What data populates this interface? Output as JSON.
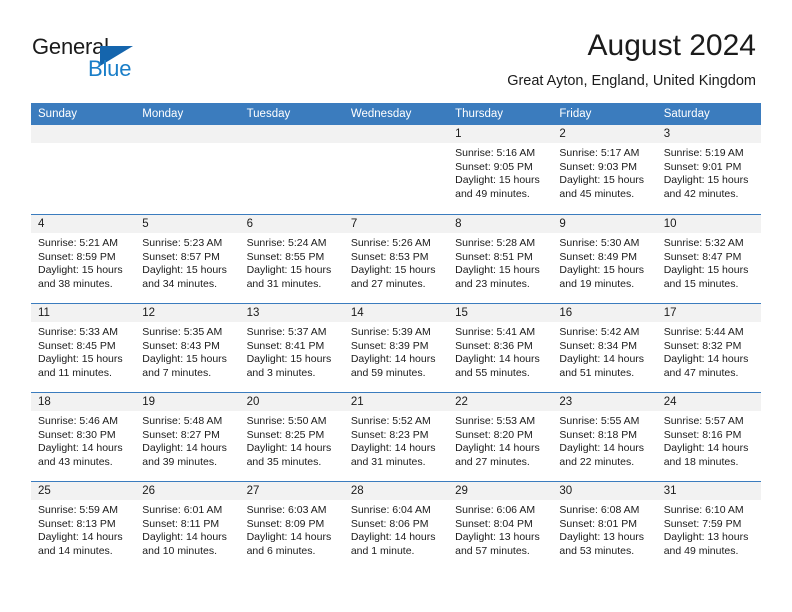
{
  "brand": {
    "name_part1": "General",
    "name_part2": "Blue",
    "triangle_color": "#1565ad",
    "blue_color": "#1a7ec8"
  },
  "header": {
    "title": "August 2024",
    "subtitle": "Great Ayton, England, United Kingdom",
    "accent_color": "#3b7cbe"
  },
  "weekdays": [
    "Sunday",
    "Monday",
    "Tuesday",
    "Wednesday",
    "Thursday",
    "Friday",
    "Saturday"
  ],
  "weeks": [
    [
      {
        "day": "",
        "empty": true
      },
      {
        "day": "",
        "empty": true
      },
      {
        "day": "",
        "empty": true
      },
      {
        "day": "",
        "empty": true
      },
      {
        "day": "1",
        "sunrise": "Sunrise: 5:16 AM",
        "sunset": "Sunset: 9:05 PM",
        "daylight1": "Daylight: 15 hours",
        "daylight2": "and 49 minutes."
      },
      {
        "day": "2",
        "sunrise": "Sunrise: 5:17 AM",
        "sunset": "Sunset: 9:03 PM",
        "daylight1": "Daylight: 15 hours",
        "daylight2": "and 45 minutes."
      },
      {
        "day": "3",
        "sunrise": "Sunrise: 5:19 AM",
        "sunset": "Sunset: 9:01 PM",
        "daylight1": "Daylight: 15 hours",
        "daylight2": "and 42 minutes."
      }
    ],
    [
      {
        "day": "4",
        "sunrise": "Sunrise: 5:21 AM",
        "sunset": "Sunset: 8:59 PM",
        "daylight1": "Daylight: 15 hours",
        "daylight2": "and 38 minutes."
      },
      {
        "day": "5",
        "sunrise": "Sunrise: 5:23 AM",
        "sunset": "Sunset: 8:57 PM",
        "daylight1": "Daylight: 15 hours",
        "daylight2": "and 34 minutes."
      },
      {
        "day": "6",
        "sunrise": "Sunrise: 5:24 AM",
        "sunset": "Sunset: 8:55 PM",
        "daylight1": "Daylight: 15 hours",
        "daylight2": "and 31 minutes."
      },
      {
        "day": "7",
        "sunrise": "Sunrise: 5:26 AM",
        "sunset": "Sunset: 8:53 PM",
        "daylight1": "Daylight: 15 hours",
        "daylight2": "and 27 minutes."
      },
      {
        "day": "8",
        "sunrise": "Sunrise: 5:28 AM",
        "sunset": "Sunset: 8:51 PM",
        "daylight1": "Daylight: 15 hours",
        "daylight2": "and 23 minutes."
      },
      {
        "day": "9",
        "sunrise": "Sunrise: 5:30 AM",
        "sunset": "Sunset: 8:49 PM",
        "daylight1": "Daylight: 15 hours",
        "daylight2": "and 19 minutes."
      },
      {
        "day": "10",
        "sunrise": "Sunrise: 5:32 AM",
        "sunset": "Sunset: 8:47 PM",
        "daylight1": "Daylight: 15 hours",
        "daylight2": "and 15 minutes."
      }
    ],
    [
      {
        "day": "11",
        "sunrise": "Sunrise: 5:33 AM",
        "sunset": "Sunset: 8:45 PM",
        "daylight1": "Daylight: 15 hours",
        "daylight2": "and 11 minutes."
      },
      {
        "day": "12",
        "sunrise": "Sunrise: 5:35 AM",
        "sunset": "Sunset: 8:43 PM",
        "daylight1": "Daylight: 15 hours",
        "daylight2": "and 7 minutes."
      },
      {
        "day": "13",
        "sunrise": "Sunrise: 5:37 AM",
        "sunset": "Sunset: 8:41 PM",
        "daylight1": "Daylight: 15 hours",
        "daylight2": "and 3 minutes."
      },
      {
        "day": "14",
        "sunrise": "Sunrise: 5:39 AM",
        "sunset": "Sunset: 8:39 PM",
        "daylight1": "Daylight: 14 hours",
        "daylight2": "and 59 minutes."
      },
      {
        "day": "15",
        "sunrise": "Sunrise: 5:41 AM",
        "sunset": "Sunset: 8:36 PM",
        "daylight1": "Daylight: 14 hours",
        "daylight2": "and 55 minutes."
      },
      {
        "day": "16",
        "sunrise": "Sunrise: 5:42 AM",
        "sunset": "Sunset: 8:34 PM",
        "daylight1": "Daylight: 14 hours",
        "daylight2": "and 51 minutes."
      },
      {
        "day": "17",
        "sunrise": "Sunrise: 5:44 AM",
        "sunset": "Sunset: 8:32 PM",
        "daylight1": "Daylight: 14 hours",
        "daylight2": "and 47 minutes."
      }
    ],
    [
      {
        "day": "18",
        "sunrise": "Sunrise: 5:46 AM",
        "sunset": "Sunset: 8:30 PM",
        "daylight1": "Daylight: 14 hours",
        "daylight2": "and 43 minutes."
      },
      {
        "day": "19",
        "sunrise": "Sunrise: 5:48 AM",
        "sunset": "Sunset: 8:27 PM",
        "daylight1": "Daylight: 14 hours",
        "daylight2": "and 39 minutes."
      },
      {
        "day": "20",
        "sunrise": "Sunrise: 5:50 AM",
        "sunset": "Sunset: 8:25 PM",
        "daylight1": "Daylight: 14 hours",
        "daylight2": "and 35 minutes."
      },
      {
        "day": "21",
        "sunrise": "Sunrise: 5:52 AM",
        "sunset": "Sunset: 8:23 PM",
        "daylight1": "Daylight: 14 hours",
        "daylight2": "and 31 minutes."
      },
      {
        "day": "22",
        "sunrise": "Sunrise: 5:53 AM",
        "sunset": "Sunset: 8:20 PM",
        "daylight1": "Daylight: 14 hours",
        "daylight2": "and 27 minutes."
      },
      {
        "day": "23",
        "sunrise": "Sunrise: 5:55 AM",
        "sunset": "Sunset: 8:18 PM",
        "daylight1": "Daylight: 14 hours",
        "daylight2": "and 22 minutes."
      },
      {
        "day": "24",
        "sunrise": "Sunrise: 5:57 AM",
        "sunset": "Sunset: 8:16 PM",
        "daylight1": "Daylight: 14 hours",
        "daylight2": "and 18 minutes."
      }
    ],
    [
      {
        "day": "25",
        "sunrise": "Sunrise: 5:59 AM",
        "sunset": "Sunset: 8:13 PM",
        "daylight1": "Daylight: 14 hours",
        "daylight2": "and 14 minutes."
      },
      {
        "day": "26",
        "sunrise": "Sunrise: 6:01 AM",
        "sunset": "Sunset: 8:11 PM",
        "daylight1": "Daylight: 14 hours",
        "daylight2": "and 10 minutes."
      },
      {
        "day": "27",
        "sunrise": "Sunrise: 6:03 AM",
        "sunset": "Sunset: 8:09 PM",
        "daylight1": "Daylight: 14 hours",
        "daylight2": "and 6 minutes."
      },
      {
        "day": "28",
        "sunrise": "Sunrise: 6:04 AM",
        "sunset": "Sunset: 8:06 PM",
        "daylight1": "Daylight: 14 hours",
        "daylight2": "and 1 minute."
      },
      {
        "day": "29",
        "sunrise": "Sunrise: 6:06 AM",
        "sunset": "Sunset: 8:04 PM",
        "daylight1": "Daylight: 13 hours",
        "daylight2": "and 57 minutes."
      },
      {
        "day": "30",
        "sunrise": "Sunrise: 6:08 AM",
        "sunset": "Sunset: 8:01 PM",
        "daylight1": "Daylight: 13 hours",
        "daylight2": "and 53 minutes."
      },
      {
        "day": "31",
        "sunrise": "Sunrise: 6:10 AM",
        "sunset": "Sunset: 7:59 PM",
        "daylight1": "Daylight: 13 hours",
        "daylight2": "and 49 minutes."
      }
    ]
  ]
}
